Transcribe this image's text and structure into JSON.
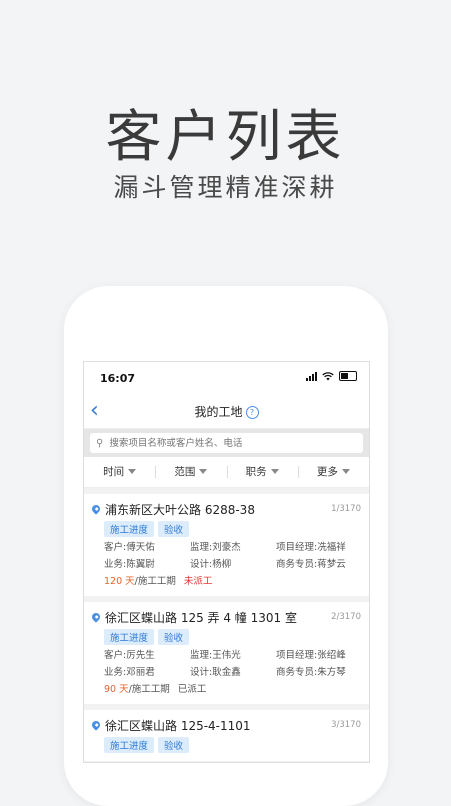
{
  "hero": {
    "title": "客户列表",
    "subtitle": "漏斗管理精准深耕"
  },
  "status_bar": {
    "time": "16:07"
  },
  "nav": {
    "title": "我的工地",
    "help": "?"
  },
  "search": {
    "placeholder": "搜索项目名称或客户姓名、电话"
  },
  "filters": [
    "时间",
    "范围",
    "职务",
    "更多"
  ],
  "sites": [
    {
      "address": "浦东新区大叶公路 6288-38",
      "count": "1/3170",
      "tags": [
        "施工进度",
        "验收"
      ],
      "rows": [
        [
          "客户:傅天佑",
          "监理:刘豪杰",
          "项目经理:冼福祥"
        ],
        [
          "业务:陈翼尉",
          "设计:杨柳",
          "商务专员:蒋梦云"
        ]
      ],
      "days": "120 天",
      "period": "/施工工期",
      "dispatch": "未派工",
      "dispatch_color": "#e53935"
    },
    {
      "address": "徐汇区蝶山路 125 弄 4 幢 1301 室",
      "count": "2/3170",
      "tags": [
        "施工进度",
        "验收"
      ],
      "rows": [
        [
          "客户:厉先生",
          "监理:王伟光",
          "项目经理:张绍峰"
        ],
        [
          "业务:邓丽君",
          "设计:耿金鑫",
          "商务专员:朱方琴"
        ]
      ],
      "days": "90 天",
      "period": "/施工工期",
      "dispatch": "已派工",
      "dispatch_color": "#555555"
    },
    {
      "address": "徐汇区蝶山路 125-4-1101",
      "count": "3/3170",
      "tags": [
        "施工进度",
        "验收"
      ],
      "rows": [],
      "days": "",
      "period": "",
      "dispatch": "",
      "dispatch_color": "#555555"
    }
  ]
}
